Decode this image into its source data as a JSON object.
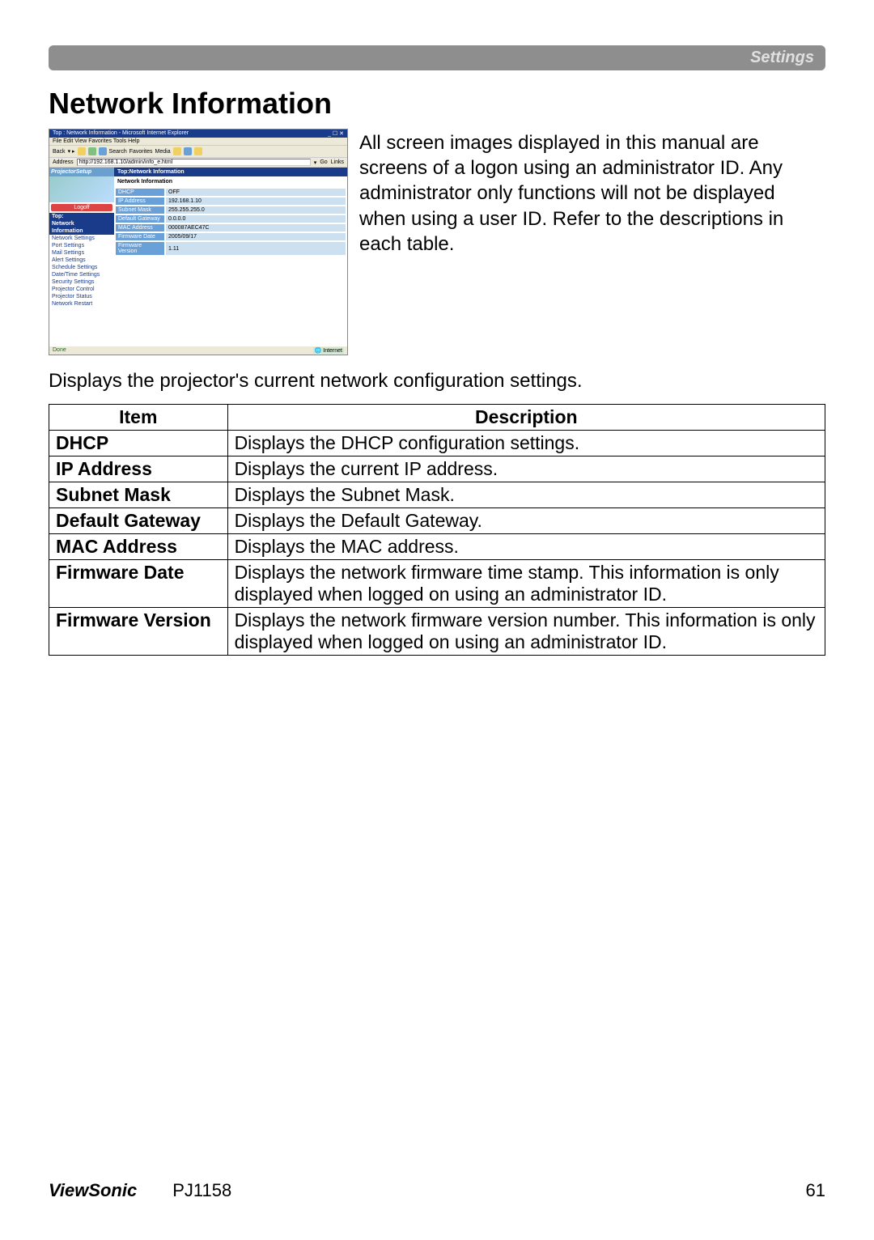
{
  "header": {
    "section": "Settings"
  },
  "title": "Network Information",
  "intro": "All screen images displayed in this manual are screens of a logon using an administrator ID. Any administrator only functions will not be displayed when using a user ID. Refer to the descriptions in each table.",
  "desc_line": "Displays the projector's current network configuration settings.",
  "table": {
    "head_item": "Item",
    "head_desc": "Description",
    "rows": [
      {
        "item": "DHCP",
        "desc": "Displays the DHCP configuration settings."
      },
      {
        "item": "IP Address",
        "desc": "Displays the current IP address."
      },
      {
        "item": "Subnet Mask",
        "desc": "Displays the Subnet Mask."
      },
      {
        "item": "Default Gateway",
        "desc": "Displays the Default Gateway."
      },
      {
        "item": "MAC Address",
        "desc": "Displays the MAC address."
      },
      {
        "item": "Firmware Date",
        "desc": "Displays the network firmware time stamp. This information is only displayed when logged on using an administrator ID."
      },
      {
        "item": "Firmware Version",
        "desc": "Displays the network firmware version number. This information is only displayed when logged on using an administrator ID."
      }
    ]
  },
  "screenshot": {
    "window_title": "Top : Network Information - Microsoft Internet Explorer",
    "menu": "File   Edit   View   Favorites   Tools   Help",
    "toolbar_back": "Back",
    "toolbar_search": "Search",
    "toolbar_fav": "Favorites",
    "toolbar_media": "Media",
    "addr_label": "Address",
    "addr_url": "http://192.168.1.10/admin/info_e.html",
    "go": "Go",
    "links": "Links",
    "setup": "ProjectorSetup",
    "main_hdr": "Top:Network Information",
    "sub_hdr": "Network Information",
    "logoff": "Logoff",
    "nav": {
      "top": "Top:",
      "network": "Network",
      "information": "Information",
      "items": [
        "Network Settings",
        "Port Settings",
        "Mail Settings",
        "Alert Settings",
        "Schedule Settings",
        "Date/Time Settings",
        "Security Settings",
        "Projector Control",
        "Projector Status",
        "Network Restart"
      ]
    },
    "rows": [
      {
        "k": "DHCP",
        "v": "OFF"
      },
      {
        "k": "IP Address",
        "v": "192.168.1.10"
      },
      {
        "k": "Subnet Mask",
        "v": "255.255.255.0"
      },
      {
        "k": "Default Gateway",
        "v": "0.0.0.0"
      },
      {
        "k": "MAC Address",
        "v": "000087AEC47C"
      },
      {
        "k": "Firmware Date",
        "v": "2005/09/17"
      },
      {
        "k": "Firmware Version",
        "v": "1.11"
      }
    ],
    "status_done": "Done",
    "status_zone": "Internet"
  },
  "footer": {
    "brand": "ViewSonic",
    "model": "PJ1158",
    "page": "61"
  }
}
